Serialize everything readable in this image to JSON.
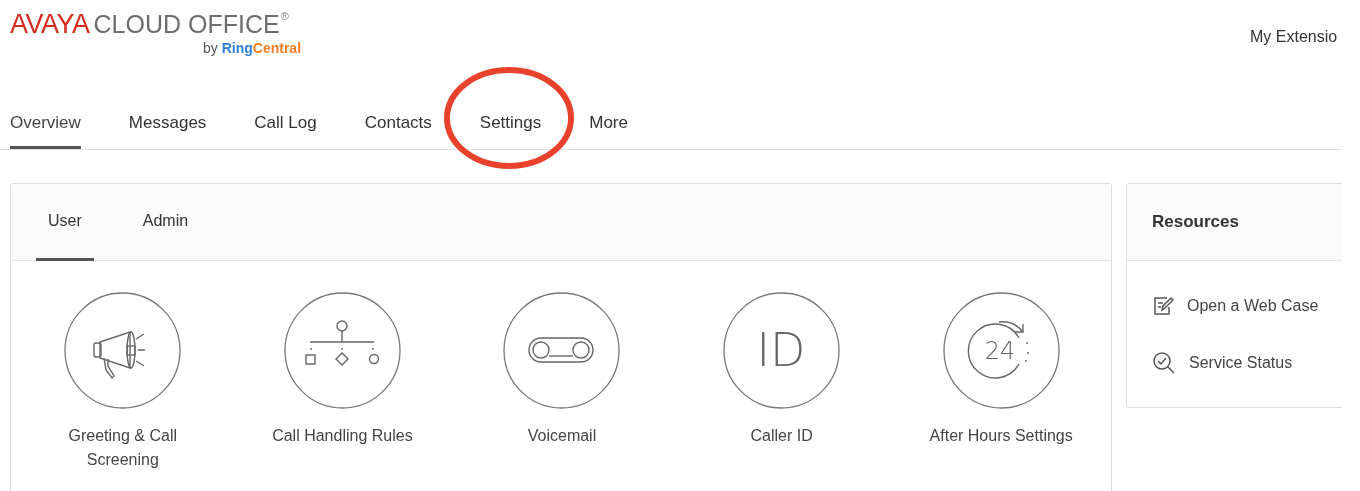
{
  "logo": {
    "brand": "AVAYA",
    "product": "CLOUD OFFICE",
    "mark": "®",
    "by": "by",
    "ring": "Ring",
    "central": "Central"
  },
  "account_menu": "My Extensio",
  "nav_tabs": [
    {
      "label": "Overview",
      "selected": true,
      "circled": false
    },
    {
      "label": "Messages",
      "selected": false,
      "circled": false
    },
    {
      "label": "Call Log",
      "selected": false,
      "circled": false
    },
    {
      "label": "Contacts",
      "selected": false,
      "circled": false
    },
    {
      "label": "Settings",
      "selected": false,
      "circled": true
    },
    {
      "label": "More",
      "selected": false,
      "circled": false
    }
  ],
  "settings_tabs": [
    {
      "label": "User",
      "selected": true
    },
    {
      "label": "Admin",
      "selected": false
    }
  ],
  "settings_items": [
    {
      "kind": "megaphone",
      "label": "Greeting & Call Screening"
    },
    {
      "kind": "tree",
      "label": "Call Handling Rules"
    },
    {
      "kind": "voicemail",
      "label": "Voicemail"
    },
    {
      "kind": "id",
      "label": "Caller ID",
      "icon_text": "ID"
    },
    {
      "kind": "clock",
      "label": "After Hours Settings",
      "icon_text": "24"
    }
  ],
  "resources": {
    "title": "Resources",
    "items": [
      {
        "kind": "edit",
        "label": "Open a Web Case"
      },
      {
        "kind": "status",
        "label": "Service Status"
      }
    ]
  }
}
